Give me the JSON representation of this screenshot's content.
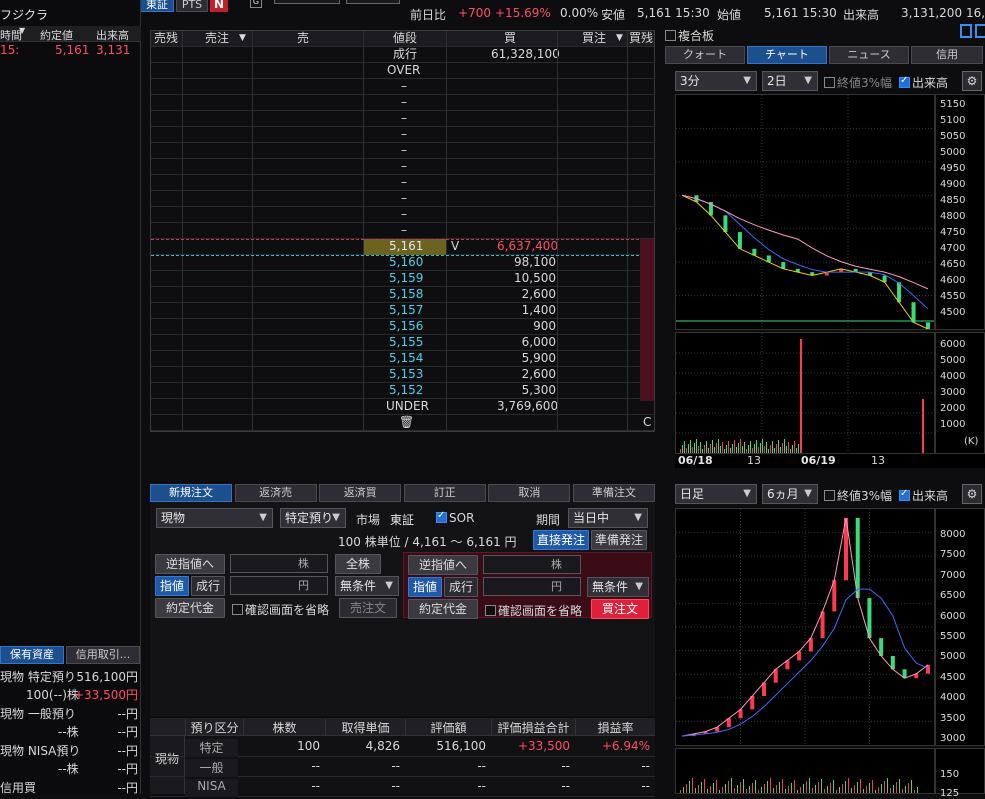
{
  "top_bar": {
    "market_tab": "東証",
    "pts_tab": "PTS",
    "n_badge": "N",
    "g_badge": "G",
    "labels": {
      "prev_close_diff": "前日比",
      "low": "安値",
      "open": "始値",
      "volume": "出来高"
    },
    "change": "+700",
    "change_pct": "+15.69%",
    "pct_zero": "0.00%",
    "low_value": "5,161 15:30",
    "open_value": "5,161 15:30",
    "volume_value": "3,131,200",
    "trailing": "16,"
  },
  "left": {
    "stock_name": "フジクラ",
    "headers": [
      "時間",
      "約定値",
      "出来高"
    ],
    "row": {
      "time": "15:",
      "price": "5,161",
      "volume": "3,131"
    },
    "tabs": [
      "保有資産",
      "信用取引..."
    ],
    "holdings": [
      {
        "l1": "現物 特定預り",
        "v1": "516,100円",
        "l2": "100(--)株",
        "v2": "+33,500円"
      },
      {
        "l1": "現物 一般預り",
        "v1": "--円",
        "l2": "--株",
        "v2": "--円"
      },
      {
        "l1": "現物 NISA預り",
        "v1": "--円",
        "l2": "--株",
        "v2": "--円"
      },
      {
        "l1": "信用買",
        "v1": "--円"
      }
    ]
  },
  "board": {
    "headers": [
      "売残",
      "売注",
      "売",
      "値段",
      "買",
      "買注",
      "買残"
    ],
    "market_row": {
      "price": "成行",
      "buy": "61,328,100"
    },
    "over": "OVER",
    "dash_count": 10,
    "current": {
      "price": "5,161",
      "mark": "V",
      "buy": "6,637,400"
    },
    "bids": [
      {
        "price": "5,160",
        "qty": "98,100"
      },
      {
        "price": "5,159",
        "qty": "10,500"
      },
      {
        "price": "5,158",
        "qty": "2,600"
      },
      {
        "price": "5,157",
        "qty": "1,400"
      },
      {
        "price": "5,156",
        "qty": "900"
      },
      {
        "price": "5,155",
        "qty": "6,000"
      },
      {
        "price": "5,154",
        "qty": "5,900"
      },
      {
        "price": "5,153",
        "qty": "2,600"
      },
      {
        "price": "5,152",
        "qty": "5,300"
      }
    ],
    "under": {
      "label": "UNDER",
      "qty": "3,769,600"
    },
    "c_label": "C"
  },
  "order": {
    "tabs": [
      "新規注文",
      "返済売",
      "返済買",
      "訂正",
      "取消",
      "準備注文"
    ],
    "type": "現物",
    "account": "特定預り",
    "market_label": "市場",
    "market": "東証",
    "sor": "SOR",
    "period_label": "期間",
    "period": "当日中",
    "unit_text": "100 株単位 / 4,161 ～ 6,161 円",
    "direct_btn": "直接発注",
    "prep_btn": "準備発注",
    "sell": {
      "stop": "逆指値へ",
      "qty_unit": "株",
      "all": "全株",
      "limit": "指値",
      "market": "成行",
      "price_unit": "円",
      "cond": "無条件",
      "amount": "約定代金",
      "confirm": "確認画面を省略",
      "submit": "売注文"
    },
    "buy": {
      "stop": "逆指値へ",
      "qty_unit": "株",
      "limit": "指値",
      "market": "成行",
      "price_unit": "円",
      "cond": "無条件",
      "amount": "約定代金",
      "confirm": "確認画面を省略",
      "submit": "買注文"
    }
  },
  "positions": {
    "side": "現物",
    "headers": [
      "預り区分",
      "株数",
      "取得単価",
      "評価額",
      "評価損益合計",
      "損益率"
    ],
    "rows": [
      {
        "kind": "特定",
        "qty": "100",
        "cost": "4,826",
        "value": "516,100",
        "pl": "+33,500",
        "rate": "+6.94%"
      },
      {
        "kind": "一般",
        "qty": "--",
        "cost": "--",
        "value": "--",
        "pl": "--",
        "rate": "--"
      },
      {
        "kind": "NISA",
        "qty": "--",
        "cost": "--",
        "value": "--",
        "pl": "--",
        "rate": "--"
      }
    ]
  },
  "right": {
    "composite": "複合板",
    "tabs": [
      "クォート",
      "チャート",
      "ニュース",
      "信用"
    ],
    "intraday": {
      "interval": "3分",
      "range": "2日",
      "opt3": "終値3%幅",
      "volume": "出来高",
      "price_ticks": [
        "5150",
        "5100",
        "5050",
        "5000",
        "4950",
        "4900",
        "4850",
        "4800",
        "4750",
        "4700",
        "4650",
        "4600",
        "4550",
        "4500"
      ],
      "vol_ticks": [
        "6000",
        "5000",
        "4000",
        "3000",
        "2000",
        "1000"
      ],
      "vol_unit": "(K)",
      "date1": "06/18",
      "d13a": "13",
      "date2": "06/19",
      "d13b": "13"
    },
    "daily": {
      "interval": "日足",
      "range": "6ヵ月",
      "opt3": "終値3%幅",
      "volume": "出来高",
      "price_ticks": [
        "8000",
        "7500",
        "7000",
        "6500",
        "6000",
        "5500",
        "5000",
        "4500",
        "4000",
        "3500",
        "3000"
      ],
      "vol_ticks": [
        "150",
        "125"
      ]
    }
  },
  "chart_data": [
    {
      "type": "line",
      "title": "",
      "series": [
        {
          "name": "",
          "values": [
            4880,
            4860,
            4820,
            4770,
            4720,
            4700,
            4680,
            4660,
            4650,
            4640,
            4650,
            4660,
            4650,
            4640,
            4620,
            4560,
            4500,
            4480
          ]
        }
      ],
      "ylim": [
        4480,
        5180
      ]
    },
    {
      "type": "line",
      "title": "",
      "series": [
        {
          "name": "",
          "values": [
            3000,
            3050,
            3100,
            3200,
            3400,
            3600,
            3900,
            4200,
            4500,
            4700,
            4900,
            5200,
            5800,
            6500,
            7900,
            6100,
            5200,
            4800,
            4500,
            4300,
            4400,
            4600
          ]
        }
      ],
      "ylim": [
        2800,
        8100
      ]
    }
  ],
  "colors": {
    "up": "#ff4d63",
    "bid": "#4fd0e8",
    "accent": "#1f5aa8"
  }
}
